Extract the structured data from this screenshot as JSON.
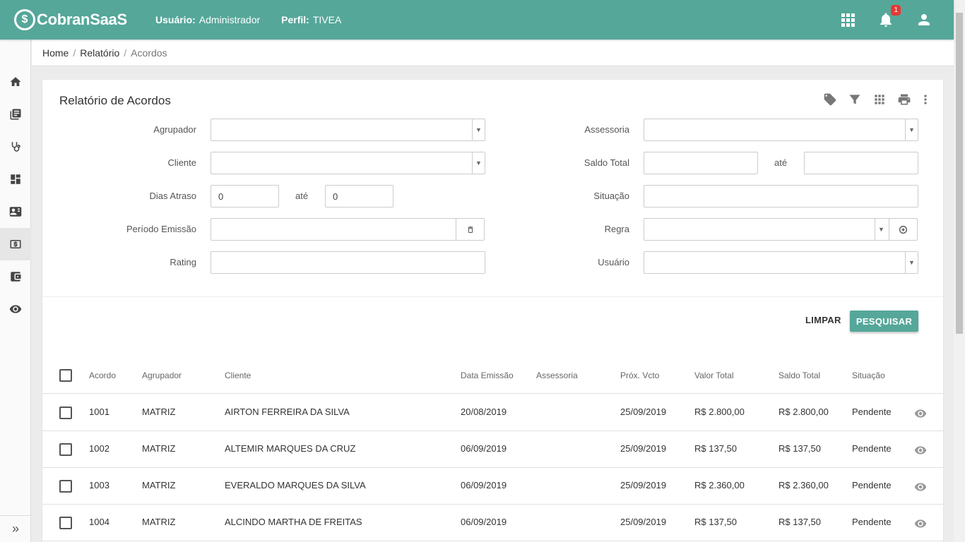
{
  "app": {
    "logo_glyph": "$",
    "logo_text": "CobranSaaS"
  },
  "header": {
    "user_label": "Usuário:",
    "user_value": "Administrador",
    "profile_label": "Perfil:",
    "profile_value": "TIVEA",
    "notifications_count": "1"
  },
  "sidebar": {
    "items": [
      "home-icon",
      "book-icon",
      "stethoscope-icon",
      "dashboard-icon",
      "contact-card-icon",
      "money-icon",
      "wallet-icon",
      "eye-icon"
    ],
    "active_index": 5,
    "expand_glyph": "»"
  },
  "breadcrumb": {
    "items": [
      "Home",
      "Relatório"
    ],
    "current": "Acordos",
    "sep": "/"
  },
  "page": {
    "title": "Relatório de Acordos"
  },
  "filters": {
    "agrupador_label": "Agrupador",
    "cliente_label": "Cliente",
    "dias_atraso_label": "Dias Atraso",
    "dias_atraso_from": "0",
    "dias_atraso_to": "0",
    "ate_label": "até",
    "periodo_emissao_label": "Período Emissão",
    "rating_label": "Rating",
    "assessoria_label": "Assessoria",
    "saldo_total_label": "Saldo Total",
    "situacao_label": "Situação",
    "regra_label": "Regra",
    "usuario_label": "Usuário"
  },
  "actions": {
    "clear_label": "LIMPAR",
    "search_label": "PESQUISAR"
  },
  "table": {
    "headers": [
      "Acordo",
      "Agrupador",
      "Cliente",
      "Data Emissão",
      "Assessoria",
      "Próx. Vcto",
      "Valor Total",
      "Saldo Total",
      "Situação"
    ],
    "rows": [
      {
        "acordo": "1001",
        "agrupador": "MATRIZ",
        "cliente": "AIRTON FERREIRA DA SILVA",
        "data_emissao": "20/08/2019",
        "assessoria": "",
        "prox_vcto": "25/09/2019",
        "valor_total": "R$ 2.800,00",
        "saldo_total": "R$ 2.800,00",
        "situacao": "Pendente"
      },
      {
        "acordo": "1002",
        "agrupador": "MATRIZ",
        "cliente": "ALTEMIR MARQUES DA CRUZ",
        "data_emissao": "06/09/2019",
        "assessoria": "",
        "prox_vcto": "25/09/2019",
        "valor_total": "R$ 137,50",
        "saldo_total": "R$ 137,50",
        "situacao": "Pendente"
      },
      {
        "acordo": "1003",
        "agrupador": "MATRIZ",
        "cliente": "EVERALDO MARQUES DA SILVA",
        "data_emissao": "06/09/2019",
        "assessoria": "",
        "prox_vcto": "25/09/2019",
        "valor_total": "R$ 2.360,00",
        "saldo_total": "R$ 2.360,00",
        "situacao": "Pendente"
      },
      {
        "acordo": "1004",
        "agrupador": "MATRIZ",
        "cliente": "ALCINDO MARTHA DE FREITAS",
        "data_emissao": "06/09/2019",
        "assessoria": "",
        "prox_vcto": "25/09/2019",
        "valor_total": "R$ 137,50",
        "saldo_total": "R$ 137,50",
        "situacao": "Pendente"
      }
    ]
  },
  "colors": {
    "primary": "#55a79a",
    "badge": "#e53935"
  }
}
